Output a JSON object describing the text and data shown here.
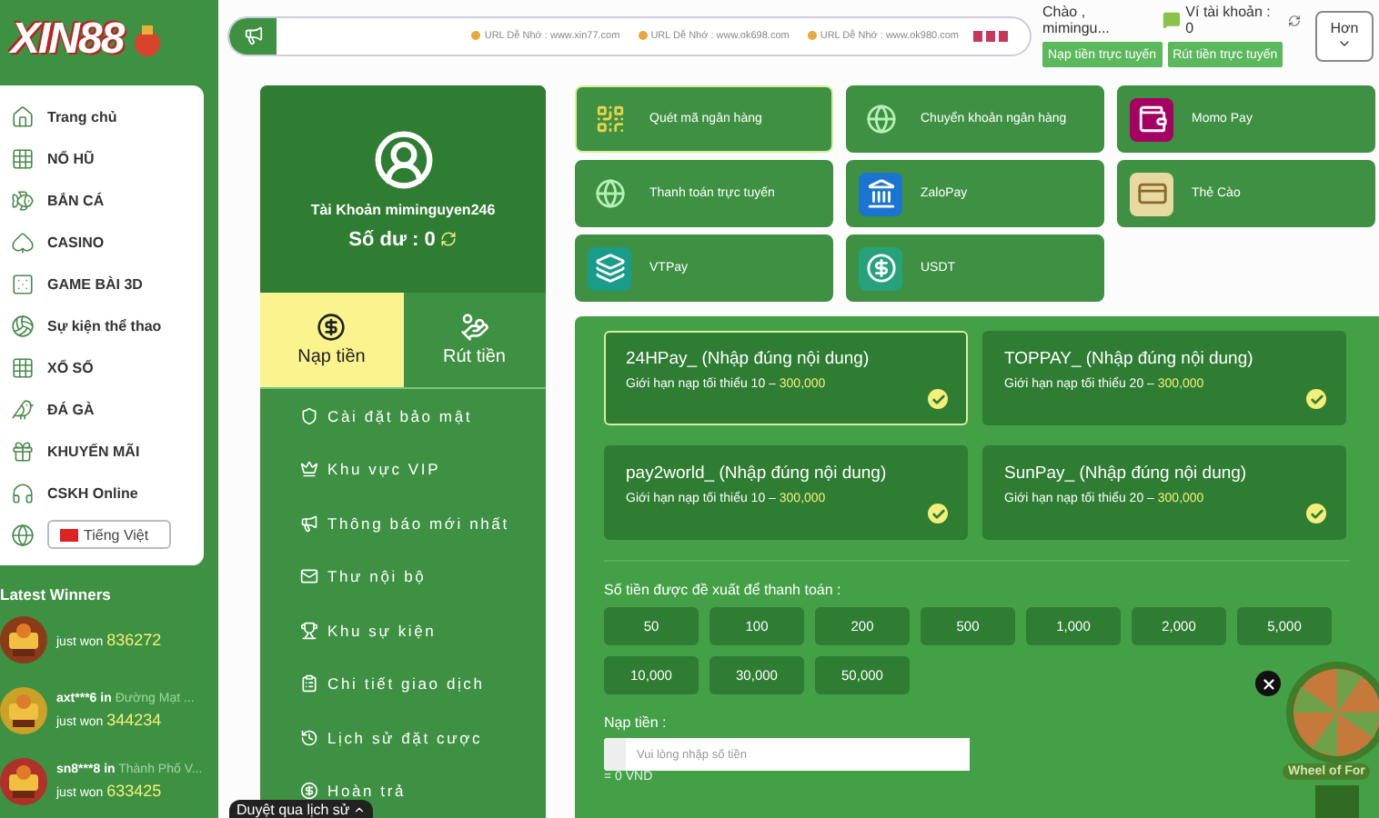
{
  "logo": {
    "text": "XIN88"
  },
  "announcement": {
    "items": [
      "URL Dễ Nhớ : www.xin77.com",
      "URL Dễ Nhớ : www.ok698.com",
      "URL Dễ Nhớ : www.ok980.com"
    ]
  },
  "user_box": {
    "greeting": "Chào , mimingu...",
    "wallet": "Ví tài khoản : 0",
    "buttons": [
      "Nạp tiền trực tuyến",
      "Rút tiền trực tuyến"
    ]
  },
  "more_button": "Hơn",
  "sidebar": {
    "items": [
      {
        "label": "Trang chủ",
        "selected": false
      },
      {
        "label": "NỔ HŨ",
        "selected": false
      },
      {
        "label": "BẮN CÁ",
        "selected": false
      },
      {
        "label": "CASINO",
        "selected": false
      },
      {
        "label": "GAME BÀI 3D",
        "selected": false
      },
      {
        "label": "Sự kiện thể thao",
        "selected": false
      },
      {
        "label": "XỔ SỐ",
        "selected": false
      },
      {
        "label": "ĐÁ GÀ",
        "selected": false
      },
      {
        "label": "KHUYẾN MÃI",
        "selected": false
      },
      {
        "label": "CSKH Online",
        "selected": false
      }
    ],
    "language": "Tiếng Việt"
  },
  "winners": {
    "title": "Latest Winners",
    "items": [
      {
        "text": "just won",
        "amount": "836272"
      },
      {
        "user": "axt***6 in",
        "game": "Đường Mạt ...",
        "text": "just won",
        "amount": "344234"
      },
      {
        "user": "sn8***8 in",
        "game": "Thành Phố V...",
        "text": "just won",
        "amount": "633425"
      }
    ]
  },
  "account": {
    "title": "Tài Khoản miminguyen246",
    "balance": "Số dư : 0",
    "tabs": [
      {
        "label": "Nạp tiền",
        "selected": true
      },
      {
        "label": "Rút tiền",
        "selected": false
      }
    ],
    "menu": [
      "Cài đặt bảo mật",
      "Khu vực VIP",
      "Thông báo mới nhất",
      "Thư nội bộ",
      "Khu sự kiện",
      "Chi tiết giao dịch",
      "Lịch sử đặt cược",
      "Hoàn trả"
    ]
  },
  "payment_methods": [
    {
      "label": "Quét mã ngân hàng",
      "selected": true
    },
    {
      "label": "Chuyển khoản ngân hàng",
      "selected": false
    },
    {
      "label": "Momo Pay",
      "selected": false
    },
    {
      "label": "Thanh toán trực tuyến",
      "selected": false
    },
    {
      "label": "ZaloPay",
      "selected": false
    },
    {
      "label": "Thẻ Cào",
      "selected": false
    },
    {
      "label": "VTPay",
      "selected": false
    },
    {
      "label": "USDT",
      "selected": false
    }
  ],
  "channels": [
    {
      "name": "24HPay_  (Nhập đúng nội dung)",
      "limit": "Giới hạn nạp tối thiểu 10 –",
      "max": "300,000",
      "selected": true
    },
    {
      "name": "TOPPAY_  (Nhập đúng nội dung)",
      "limit": "Giới hạn nạp tối thiểu 20 –",
      "max": "300,000",
      "selected": false
    },
    {
      "name": "pay2world_  (Nhập đúng nội dung)",
      "limit": "Giới hạn nạp tối thiểu 10 –",
      "max": "300,000",
      "selected": false
    },
    {
      "name": "SunPay_  (Nhập đúng nội dung)",
      "limit": "Giới hạn nạp tối thiểu 20 –",
      "max": "300,000",
      "selected": false
    }
  ],
  "amounts": {
    "label": "Số tiền được đề xuất để thanh toán :",
    "values": [
      "50",
      "100",
      "200",
      "500",
      "1,000",
      "2,000",
      "5,000",
      "10,000",
      "30,000",
      "50,000"
    ]
  },
  "deposit": {
    "label": "Nạp tiền :",
    "placeholder": "Vui lòng nhập số tiền",
    "total": "= 0 VND"
  },
  "wheel": {
    "label": "Wheel of For"
  },
  "tooltip": {
    "text": "Duyệt qua lịch sử"
  }
}
